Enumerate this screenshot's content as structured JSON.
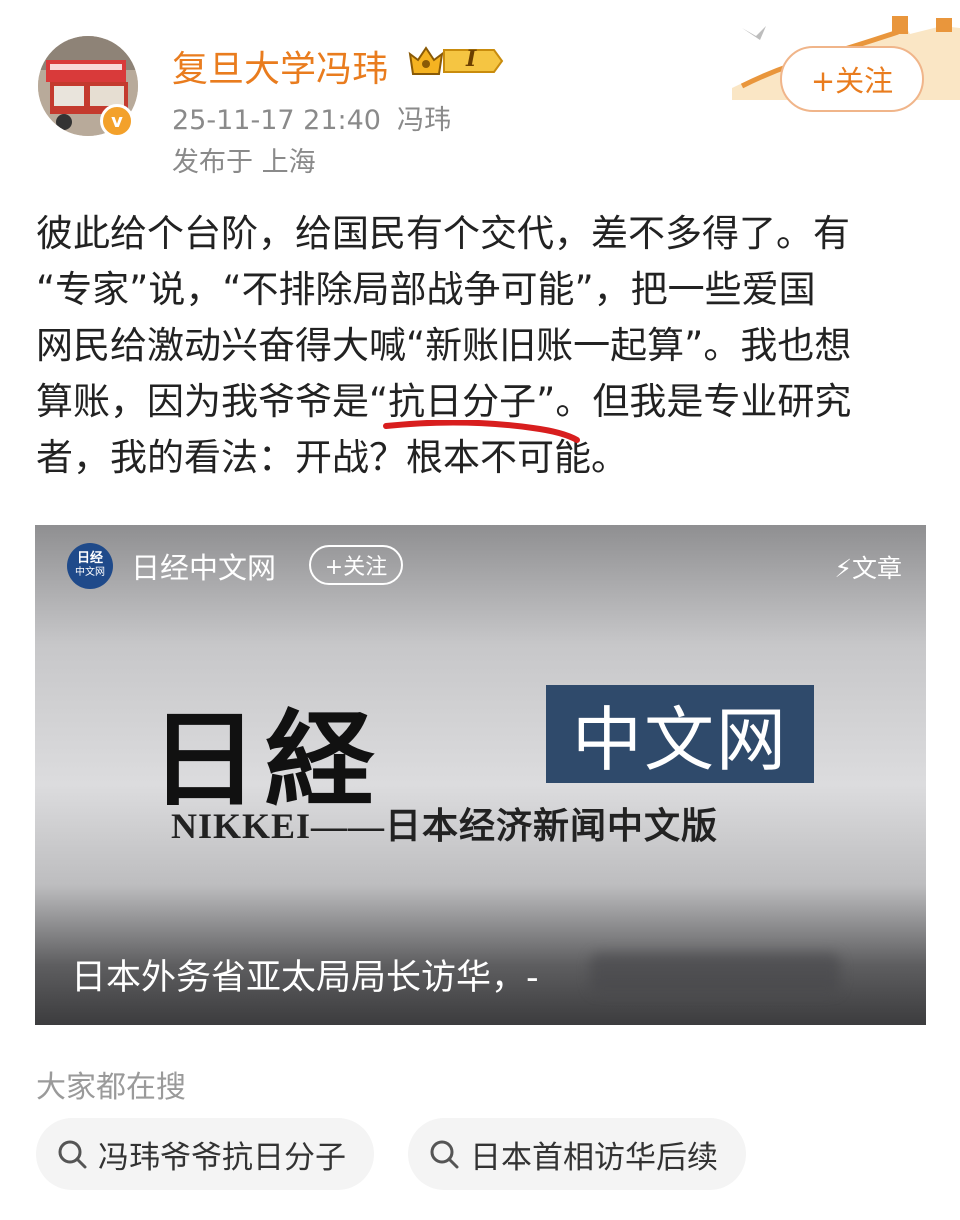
{
  "header": {
    "username": "复旦大学冯玮",
    "badge_level": "I",
    "date": "25-11-17 21:40",
    "source": "冯玮",
    "location": "发布于 上海",
    "follow_label": "+关注"
  },
  "post": {
    "lines": [
      "彼此给个台阶，给国民有个交代，差不多得了。有",
      "“专家”说，“不排除局部战争可能”，把一些爱国",
      "网民给激动兴奋得大喊“新账旧账一起算”。我也想",
      "算账，因为我爷爷是“抗日分子”。但我是专业研究",
      "者，我的看法：开战？根本不可能。"
    ]
  },
  "card": {
    "logo_text_top": "日经",
    "logo_text_bottom": "中文网",
    "source": "日经中文网",
    "follow_label": "+关注",
    "type_label": "⚡文章",
    "nikkei_jp": "日経",
    "nikkei_box": "中文网",
    "nikkei_sub": "NIKKEI——日本经济新闻中文版",
    "caption": "日本外务省亚太局局长访华，-"
  },
  "search": {
    "title": "大家都在搜",
    "chips": [
      "冯玮爷爷抗日分子",
      "日本首相访华后续"
    ]
  },
  "colors": {
    "accent": "#e97c1e",
    "meta": "#8a8a8a",
    "underline": "#d81e1e",
    "nikkei_box": "#2f4a6b"
  }
}
